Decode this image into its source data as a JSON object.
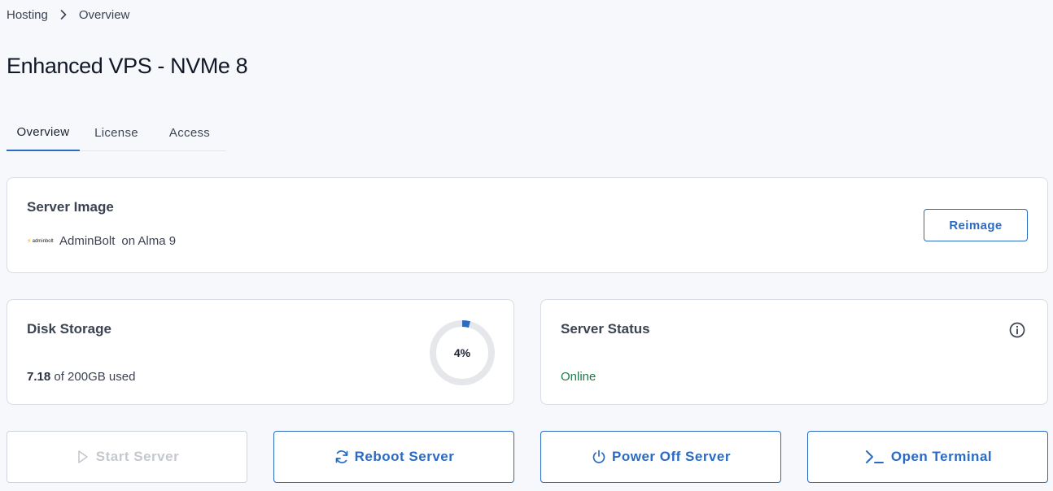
{
  "breadcrumb": {
    "root": "Hosting",
    "current": "Overview"
  },
  "page": {
    "title": "Enhanced VPS - NVMe 8"
  },
  "tabs": [
    {
      "label": "Overview",
      "active": true
    },
    {
      "label": "License",
      "active": false
    },
    {
      "label": "Access",
      "active": false
    }
  ],
  "server_image": {
    "title": "Server Image",
    "logo_text": "adminbolt",
    "name": "AdminBolt",
    "os": "on Alma 9",
    "button": "Reimage"
  },
  "disk": {
    "title": "Disk Storage",
    "used": "7.18",
    "of_text": "of 200GB used",
    "percent_label": "4%",
    "percent": 0.04
  },
  "status": {
    "title": "Server Status",
    "value": "Online",
    "info_icon": "info-circle-icon"
  },
  "actions": {
    "start": {
      "label": "Start Server",
      "icon": "play-icon",
      "disabled": true
    },
    "reboot": {
      "label": "Reboot Server",
      "icon": "refresh-icon"
    },
    "power": {
      "label": "Power Off Server",
      "icon": "power-icon"
    },
    "terminal": {
      "label": "Open Terminal",
      "icon": "terminal-icon"
    }
  },
  "colors": {
    "accent": "#2a6bc4",
    "online": "#1f7a4d",
    "ring_track": "#e5e7eb",
    "ring_fill": "#2a6bc4"
  }
}
